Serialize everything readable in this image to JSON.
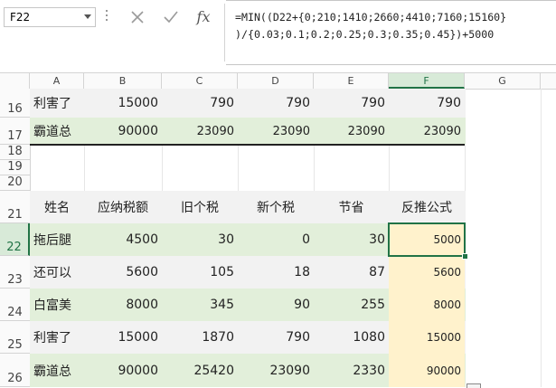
{
  "name_box": "F22",
  "formula": {
    "line1": "=MIN((D22+{0;210;1410;2660;4410;7160;15160}",
    "line2": ")/{0.03;0.1;0.2;0.25;0.3;0.35;0.45})+5000"
  },
  "columns": [
    "A",
    "B",
    "C",
    "D",
    "E",
    "F",
    "G"
  ],
  "selected_column": "F",
  "rows": {
    "r16": {
      "num": "16",
      "a": "利害了",
      "b": "15000",
      "c": "790",
      "d": "790",
      "e": "790",
      "f": "790"
    },
    "r17": {
      "num": "17",
      "a": "霸道总",
      "b": "90000",
      "c": "23090",
      "d": "23090",
      "e": "23090",
      "f": "23090"
    },
    "r18": {
      "num": "18"
    },
    "r19": {
      "num": "19"
    },
    "r20": {
      "num": "20"
    },
    "r21": {
      "num": "21",
      "a": "姓名",
      "b": "应纳税额",
      "c": "旧个税",
      "d": "新个税",
      "e": "节省",
      "f": "反推公式"
    },
    "r22": {
      "num": "22",
      "a": "拖后腿",
      "b": "4500",
      "c": "30",
      "d": "0",
      "e": "30",
      "f": "5000"
    },
    "r23": {
      "num": "23",
      "a": "还可以",
      "b": "5600",
      "c": "105",
      "d": "18",
      "e": "87",
      "f": "5600"
    },
    "r24": {
      "num": "24",
      "a": "白富美",
      "b": "8000",
      "c": "345",
      "d": "90",
      "e": "255",
      "f": "8000"
    },
    "r25": {
      "num": "25",
      "a": "利害了",
      "b": "15000",
      "c": "1870",
      "d": "790",
      "e": "1080",
      "f": "15000"
    },
    "r26": {
      "num": "26",
      "a": "霸道总",
      "b": "90000",
      "c": "25420",
      "d": "23090",
      "e": "2330",
      "f": "90000"
    }
  },
  "icons": {
    "cancel": "close-icon",
    "enter": "check-icon",
    "function": "fx-icon"
  }
}
